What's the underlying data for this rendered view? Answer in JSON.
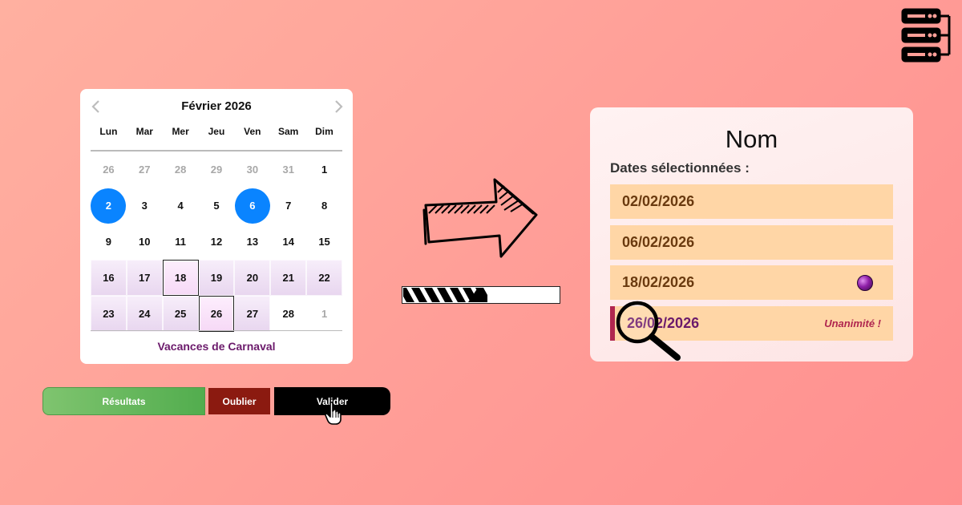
{
  "calendar": {
    "title": "Février 2026",
    "prev_icon": "chevron-left-icon",
    "next_icon": "chevron-right-icon",
    "weekdays": [
      "Lun",
      "Mar",
      "Mer",
      "Jeu",
      "Ven",
      "Sam",
      "Dim"
    ],
    "weeks": [
      [
        {
          "d": "26",
          "muted": true
        },
        {
          "d": "27",
          "muted": true
        },
        {
          "d": "28",
          "muted": true
        },
        {
          "d": "29",
          "muted": true
        },
        {
          "d": "30",
          "muted": true
        },
        {
          "d": "31",
          "muted": true
        },
        {
          "d": "1"
        }
      ],
      [
        {
          "d": "2",
          "selected": true
        },
        {
          "d": "3"
        },
        {
          "d": "4"
        },
        {
          "d": "5"
        },
        {
          "d": "6",
          "selected": true
        },
        {
          "d": "7"
        },
        {
          "d": "8"
        }
      ],
      [
        {
          "d": "9"
        },
        {
          "d": "10"
        },
        {
          "d": "11"
        },
        {
          "d": "12"
        },
        {
          "d": "13"
        },
        {
          "d": "14"
        },
        {
          "d": "15"
        }
      ],
      [
        {
          "d": "16",
          "vacation": true
        },
        {
          "d": "17",
          "vacation": true
        },
        {
          "d": "18",
          "vacation": true,
          "boxed": true
        },
        {
          "d": "19",
          "vacation": true
        },
        {
          "d": "20",
          "vacation": true
        },
        {
          "d": "21",
          "vacation": true
        },
        {
          "d": "22",
          "vacation": true
        }
      ],
      [
        {
          "d": "23",
          "vacation": true
        },
        {
          "d": "24",
          "vacation": true
        },
        {
          "d": "25",
          "vacation": true
        },
        {
          "d": "26",
          "vacation": true,
          "boxed": true
        },
        {
          "d": "27",
          "vacation": true
        },
        {
          "d": "28"
        },
        {
          "d": "1",
          "muted": true
        }
      ]
    ],
    "footer": "Vacances de Carnaval"
  },
  "buttons": {
    "results": "Résultats",
    "forget": "Oublier",
    "validate": "Valider"
  },
  "progress": {
    "value": 0.54
  },
  "panel": {
    "title": "Nom",
    "subtitle": "Dates sélectionnées :",
    "dates": [
      "02/02/2026",
      "06/02/2026",
      "18/02/2026",
      "26/02/2026"
    ],
    "unanimity": "Unanimité !"
  },
  "icons": [
    "server-icon",
    "arrow-right-icon",
    "magnifier-icon",
    "hand-cursor-icon"
  ],
  "colors": {
    "selected_day": "#0a84ff",
    "vacation_label": "#6b1a6b",
    "date_row": "#ffd6a6",
    "results_button": "#52ad4e",
    "forget_button": "#8b1a10",
    "validate_button": "#000000"
  }
}
